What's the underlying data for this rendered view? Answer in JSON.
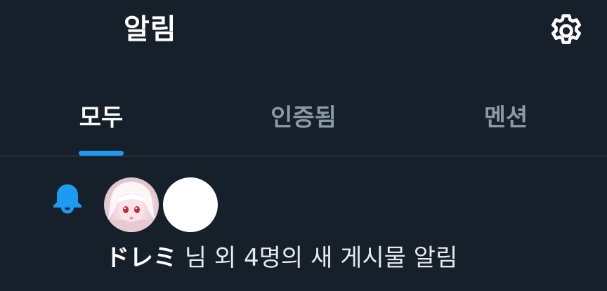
{
  "header": {
    "title": "알림",
    "settings_icon": "gear-icon"
  },
  "tabs": [
    {
      "label": "모두",
      "active": true
    },
    {
      "label": "인증됨",
      "active": false
    },
    {
      "label": "멘션",
      "active": false
    }
  ],
  "notifications": [
    {
      "icon": "bell-icon",
      "avatars": [
        "anime-girl-avatar",
        "blank-white-avatar"
      ],
      "user": "ドレミ",
      "text": " 님 외 4명의 새 게시물 알림"
    }
  ],
  "colors": {
    "background": "#15202b",
    "accent": "#1d9bf0",
    "inactive_tab": "#8b98a5",
    "divider": "#38444d"
  }
}
